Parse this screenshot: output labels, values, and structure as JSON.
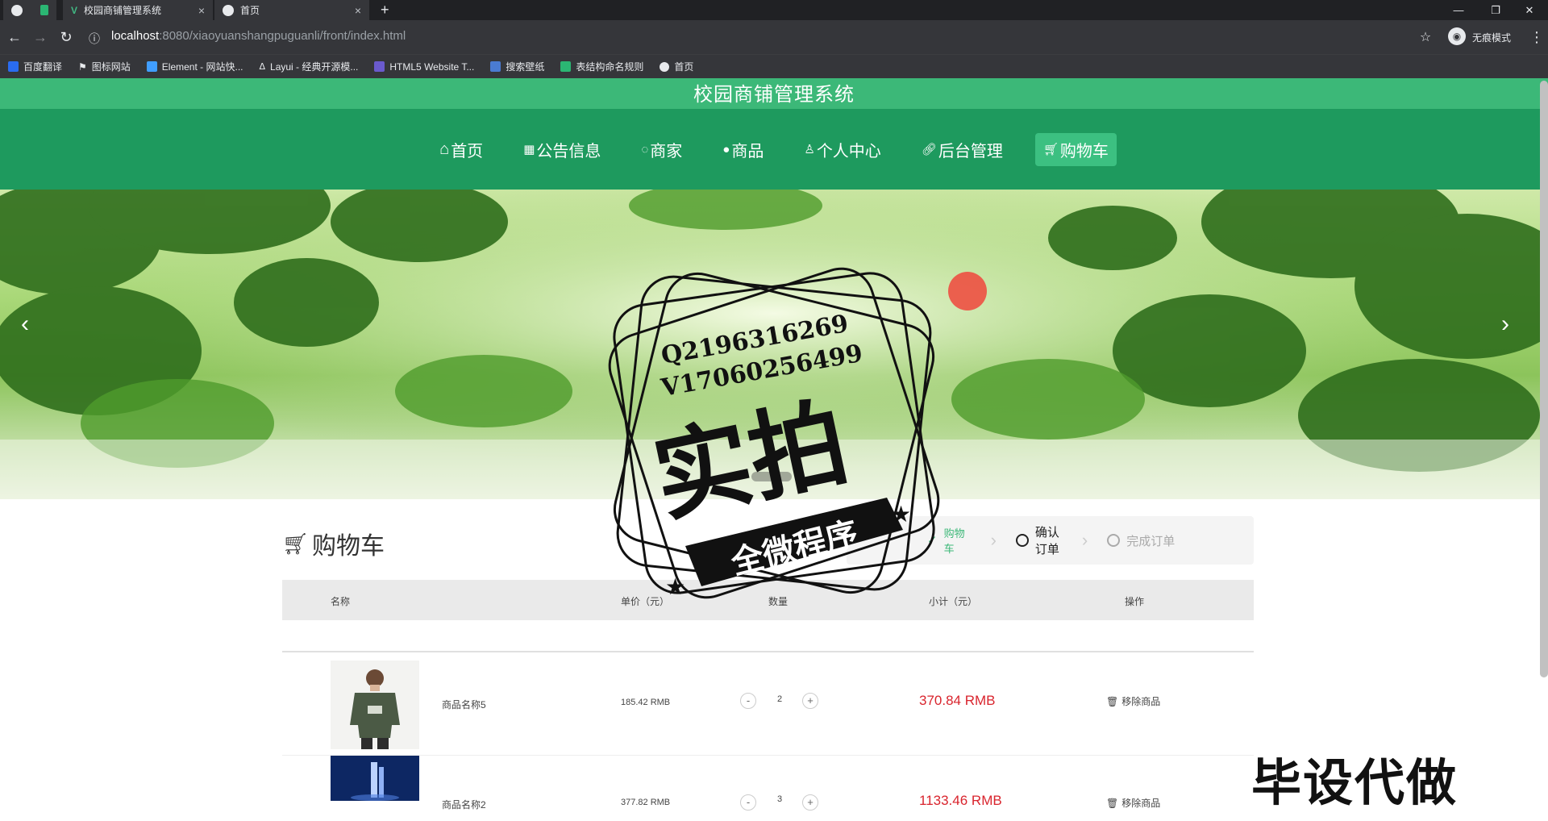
{
  "browser": {
    "tabs": [
      {
        "label": "校园商铺管理系统",
        "active": false
      },
      {
        "label": "首页",
        "active": true
      }
    ],
    "new_tab": "+",
    "url_host": "localhost",
    "url_path": ":8080/xiaoyuanshangpuguanli/front/index.html",
    "profile_label": "无痕模式",
    "bookmarks": [
      "百度翻译",
      "图标网站",
      "Element - 网站快...",
      "Layui - 经典开源模...",
      "HTML5 Website T...",
      "搜索壁纸",
      "表结构命名规则",
      "首页"
    ]
  },
  "site": {
    "title": "校园商铺管理系统",
    "nav": [
      {
        "label": "首页",
        "icon": "home-icon"
      },
      {
        "label": "公告信息",
        "icon": "notice-icon"
      },
      {
        "label": "商家",
        "icon": "shop-icon"
      },
      {
        "label": "商品",
        "icon": "goods-icon"
      },
      {
        "label": "个人中心",
        "icon": "user-icon"
      },
      {
        "label": "后台管理",
        "icon": "link-icon"
      },
      {
        "label": "购物车",
        "icon": "cart-icon",
        "active": true
      }
    ],
    "accent_color": "#1e9a5e",
    "topbar_color": "#3cb878"
  },
  "overlay": {
    "line1": "Q2196316269",
    "line2": "V17060256499",
    "big": "实拍",
    "ribbon": "全微程序",
    "watermark": "毕设代做"
  },
  "cart": {
    "title": "购物车",
    "steps": [
      {
        "label": "购物车",
        "state": "done"
      },
      {
        "label": "确认订单",
        "state": "current"
      },
      {
        "label": "完成订单",
        "state": "todo"
      }
    ],
    "columns": [
      "名称",
      "单价（元）",
      "数量",
      "小计（元）",
      "操作"
    ],
    "items": [
      {
        "name": "商品名称5",
        "price": "185.42 RMB",
        "qty": "2",
        "subtotal": "370.84 RMB",
        "action": "移除商品",
        "minus": "-",
        "plus": "+"
      },
      {
        "name": "商品名称2",
        "price": "377.82 RMB",
        "qty": "3",
        "subtotal": "1133.46 RMB",
        "action": "移除商品",
        "minus": "-",
        "plus": "+"
      }
    ],
    "subtotal_color": "#d9242d"
  }
}
